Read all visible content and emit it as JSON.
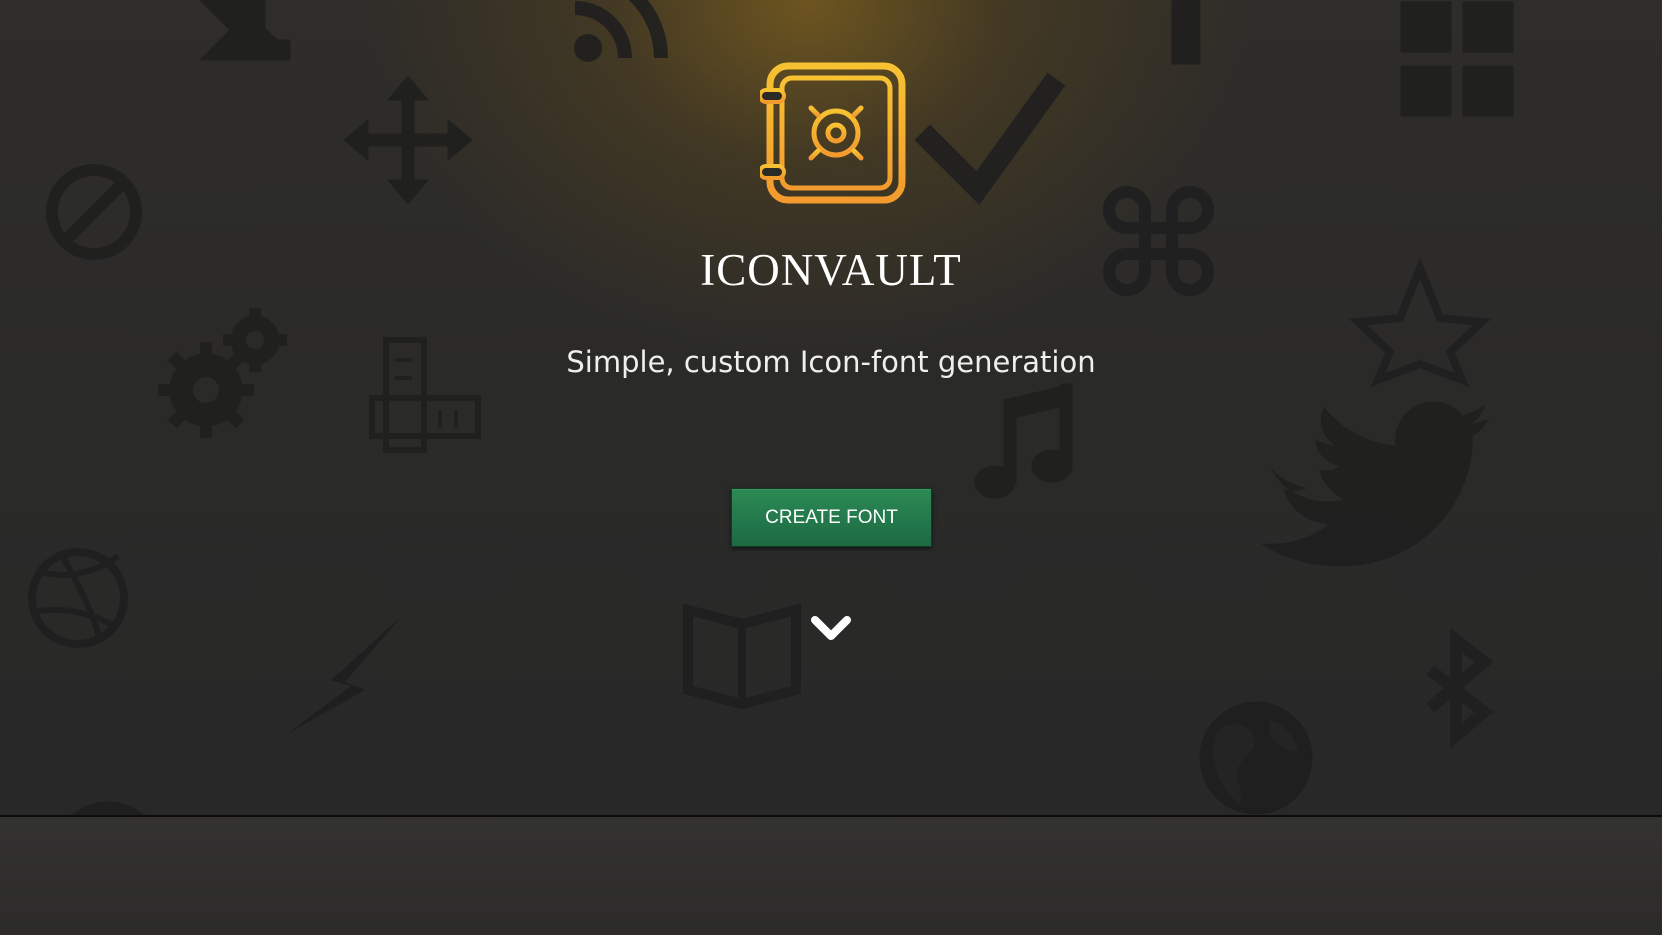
{
  "app": {
    "title": "ICONVAULT",
    "tagline": "Simple, custom Icon-font generation"
  },
  "hero": {
    "cta_label": "CREATE FONT",
    "scroll_icon": "chevron-down-icon",
    "logo_icon": "vault-gear-icon"
  },
  "background_icons": [
    "arrow-down-right-icon",
    "rss-icon",
    "grid-icon",
    "move-arrows-icon",
    "checkmark-icon",
    "ban-icon",
    "command-icon",
    "gears-icon",
    "ruler-icon",
    "star-icon",
    "music-note-icon",
    "twitter-bird-icon",
    "dribbble-ball-icon",
    "lightning-icon",
    "book-icon",
    "bluetooth-icon",
    "globe-icon"
  ],
  "colors": {
    "accent_gold": "#f5b733",
    "accent_orange": "#f29a2e",
    "button_green": "#22774a",
    "background": "#2a2a29"
  }
}
